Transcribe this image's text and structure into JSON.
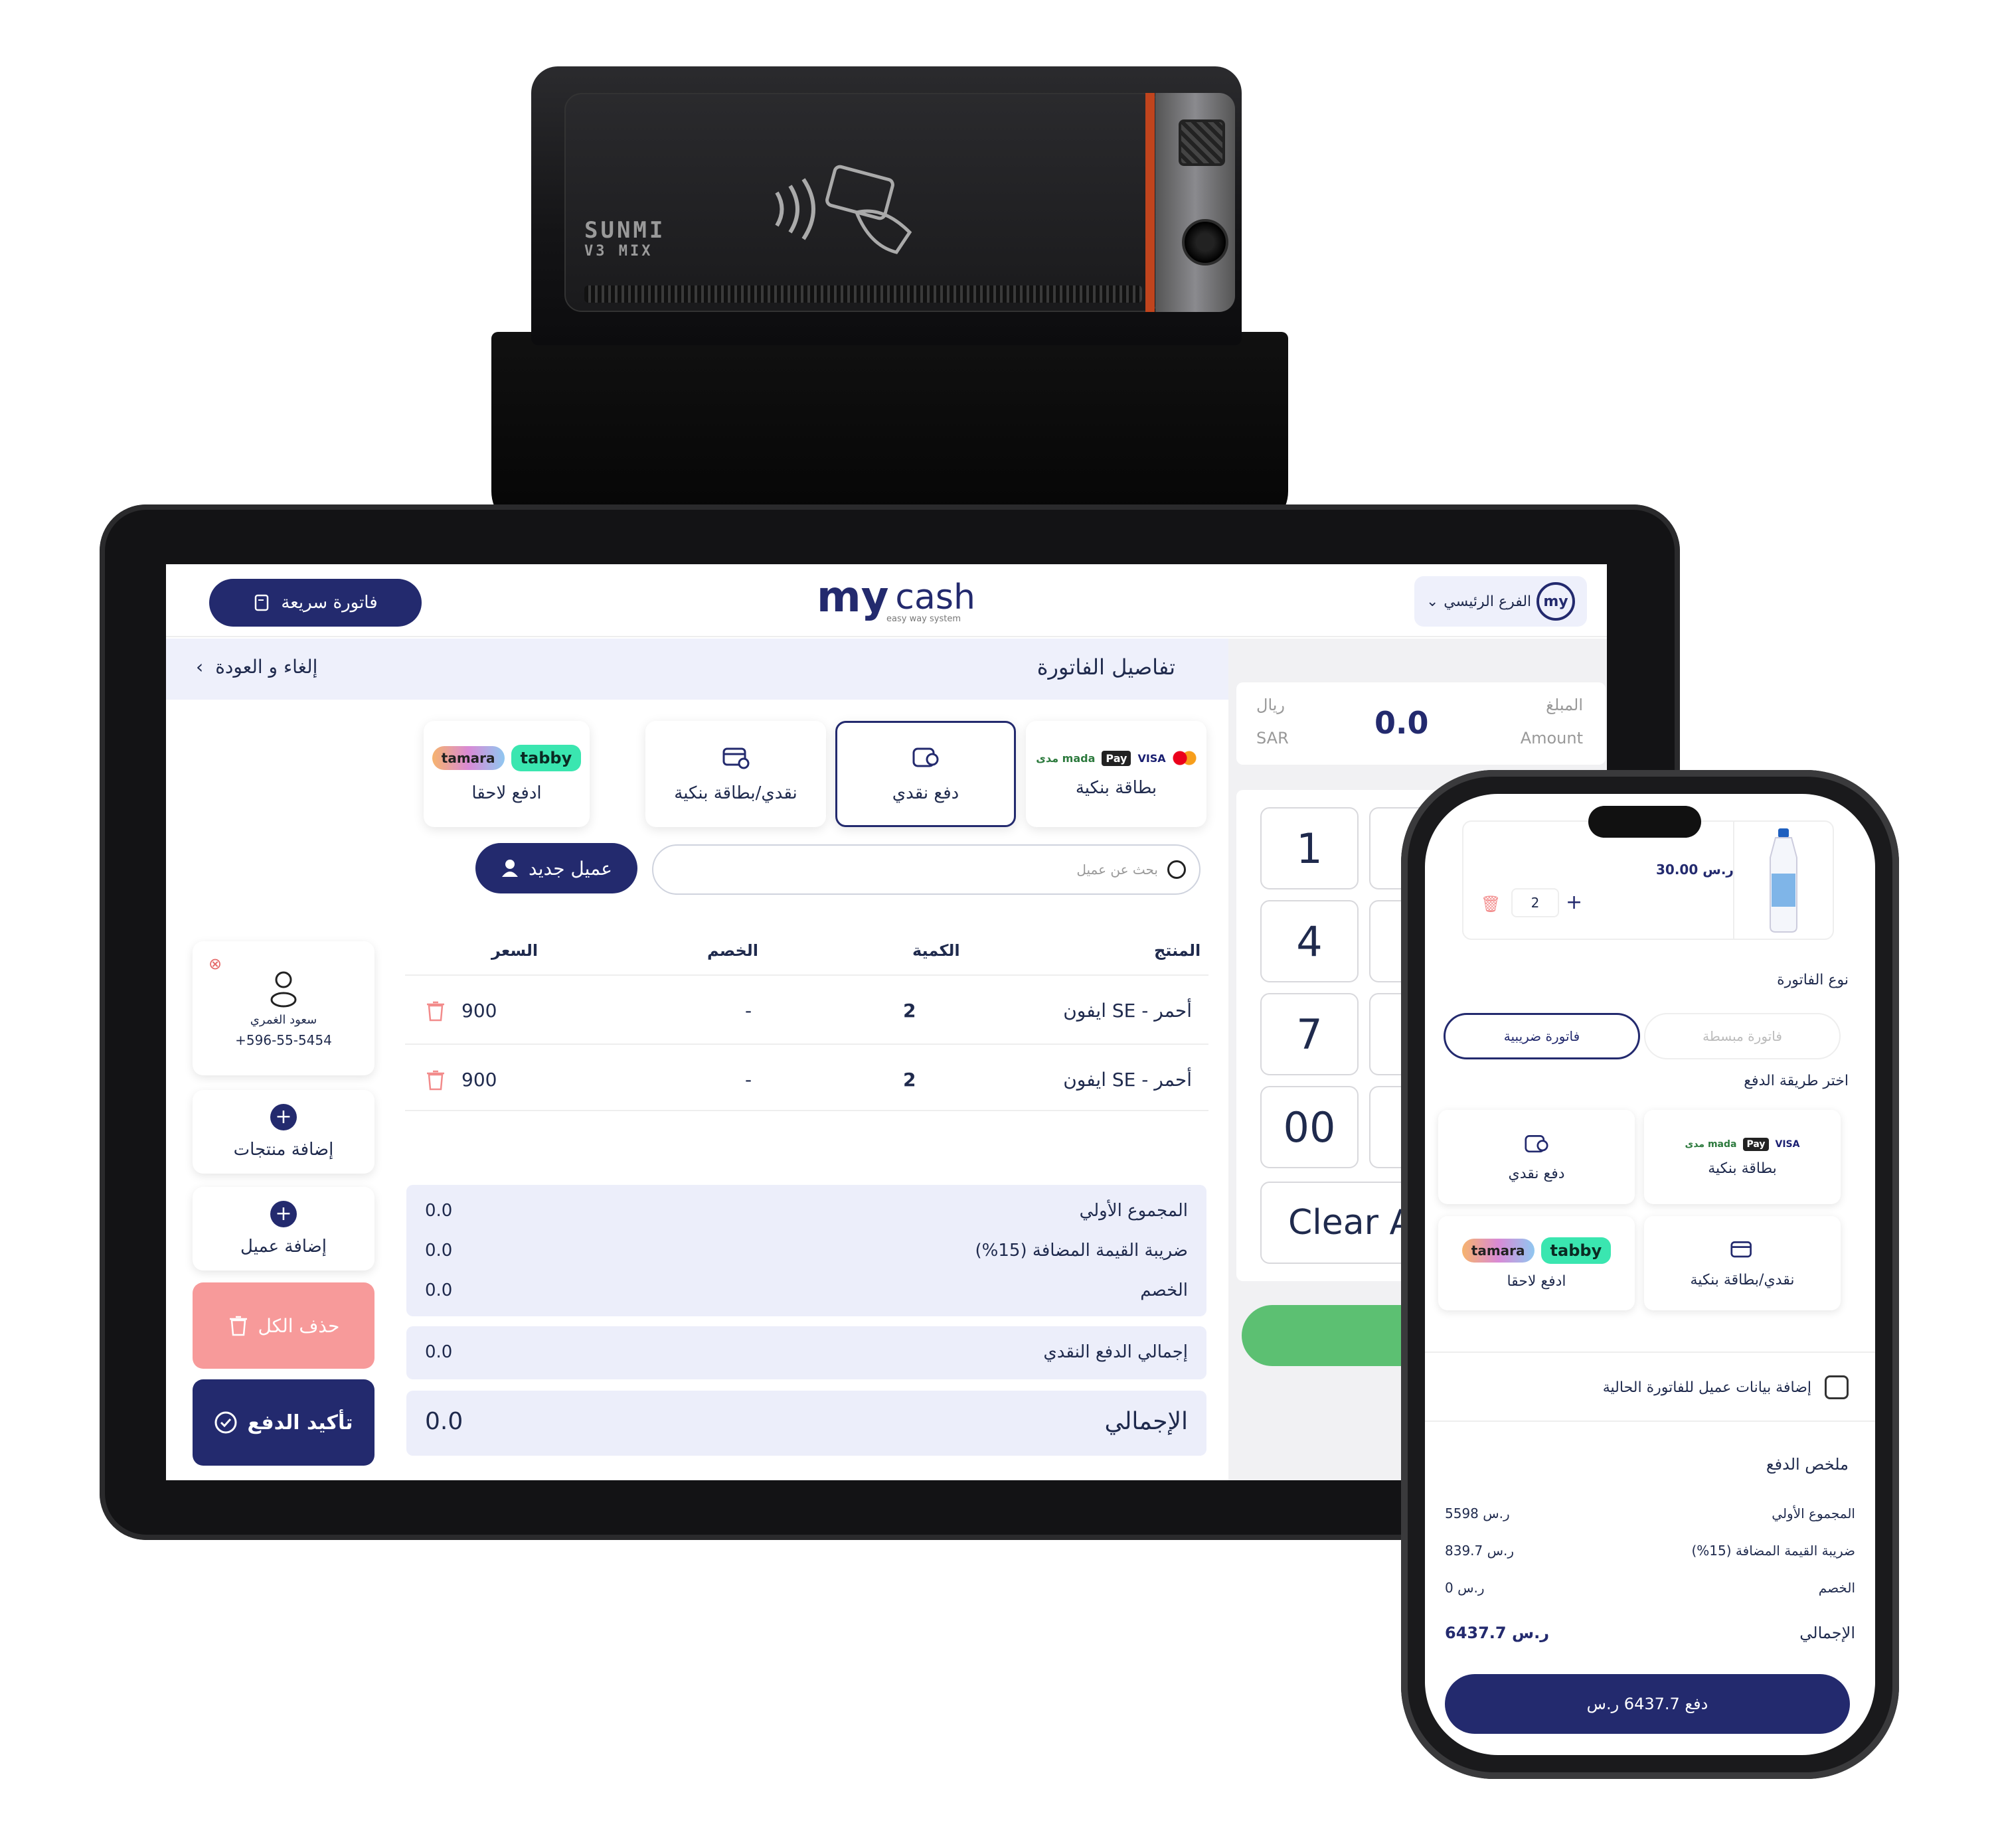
{
  "printer": {
    "brand": "SUNMI",
    "model": "V3 MIX"
  },
  "tablet": {
    "header": {
      "quick_invoice": "فاتورة سريعة",
      "logo_my": "my",
      "logo_cash": "cash",
      "logo_tagline": "easy way system",
      "branch": "الفرع الرئيسي",
      "branch_logo": "my"
    },
    "subbar": {
      "title": "تفاصيل الفاتورة",
      "cancel_back": "إلغاء و العودة"
    },
    "payment_methods": [
      {
        "label": "بطاقة بنكية",
        "brands": [
          "مدى mada",
          "Pay",
          "VISA"
        ]
      },
      {
        "label": "دفع نقدي",
        "selected": true
      },
      {
        "label": "نقدي/بطاقة بنكية"
      },
      {
        "label": "ادفع لاحقا",
        "brands": [
          "tamara",
          "tabby"
        ]
      }
    ],
    "new_customer": "عميل جديد",
    "search_placeholder": "بحث عن عميل",
    "table": {
      "headers": {
        "product": "المنتج",
        "qty": "الكمية",
        "discount": "الخصم",
        "price": "السعر"
      },
      "rows": [
        {
          "product": "ايفون SE - أحمر",
          "qty": "2",
          "discount": "-",
          "price": "900"
        },
        {
          "product": "ايفون SE - أحمر",
          "qty": "2",
          "discount": "-",
          "price": "900"
        }
      ]
    },
    "totals": {
      "subtotal_label": "المجموع الأولي",
      "subtotal": "0.0",
      "vat_label": "ضريبة القيمة المضافة (15%)",
      "vat": "0.0",
      "discount_label": "الخصم",
      "discount": "0.0",
      "cash_label": "إجمالي الدفع  النقدي",
      "cash": "0.0",
      "total_label": "الإجمالي",
      "total": "0.0"
    },
    "customer": {
      "name": "سعود الغمري",
      "phone": "+596-55-5454"
    },
    "sidebar": {
      "add_products": "إضافة منتجات",
      "add_customer": "إضافة عميل",
      "delete_all": "حذف الكل",
      "confirm_payment": "تأكيد الدفع"
    },
    "amount": {
      "label_ar": "المبلغ",
      "label_en": "Amount",
      "value": "0.0",
      "currency_ar": "ريال",
      "currency_en": "SAR"
    },
    "keypad": [
      "1",
      "4",
      "7",
      "00",
      "Clear A"
    ]
  },
  "phone": {
    "product": {
      "price": "30.00 ر.س",
      "qty": "2"
    },
    "invoice_type_label": "نوع الفاتورة",
    "invoice_types": {
      "simplified": "فاتورة مبسطة",
      "tax": "فاتورة ضريبية"
    },
    "choose_payment_label": "اختر طريقة الدفع",
    "payments": {
      "card": "بطاقة بنكية",
      "cash": "دفع نقدي",
      "mixed": "نقدي/بطاقة بنكية",
      "later": "ادفع لاحقا"
    },
    "add_customer_data": "إضافة بيانات عميل للفاتورة الحالية",
    "summary_title": "ملخص الدفع",
    "summary": [
      {
        "label": "المجموع الأولي",
        "value": "5598 ر.س"
      },
      {
        "label": "ضريبة القيمة المضافة (15%)",
        "value": "839.7 ر.س"
      },
      {
        "label": "الخصم",
        "value": "0 ر.س"
      }
    ],
    "total_label": "الإجمالي",
    "total_value": "6437.7 ر.س",
    "pay_button": "دفع 6437.7 ر.س"
  },
  "colors": {
    "navy": "#232a6e",
    "panel": "#eceefa",
    "delete": "#f79a9a",
    "green": "#5cc072",
    "tabby": "#3ae6b0"
  }
}
